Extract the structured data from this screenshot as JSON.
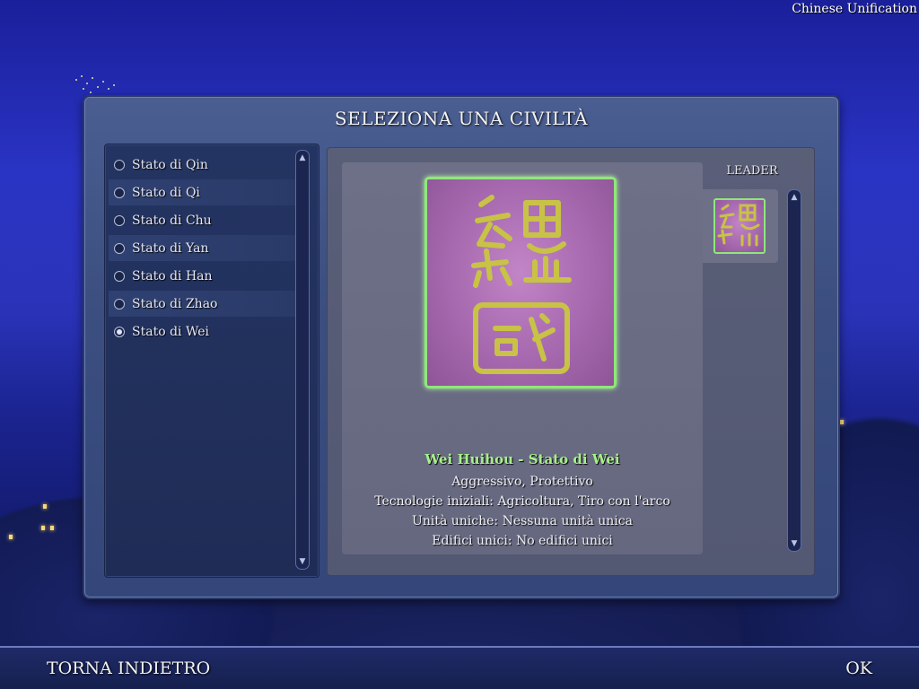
{
  "top_title": "Chinese Unification",
  "dialog": {
    "title": "SELEZIONA UNA CIVILTÀ"
  },
  "civilizations": [
    {
      "label": "Stato di Qin",
      "selected": false
    },
    {
      "label": "Stato di Qi",
      "selected": false
    },
    {
      "label": "Stato di Chu",
      "selected": false
    },
    {
      "label": "Stato di Yan",
      "selected": false
    },
    {
      "label": "Stato di Han",
      "selected": false
    },
    {
      "label": "Stato di Zhao",
      "selected": false
    },
    {
      "label": "Stato di Wei",
      "selected": true
    }
  ],
  "detail": {
    "leader_label": "LEADER",
    "civ_name": "Wei Huihou - Stato di Wei",
    "traits": "Aggressivo, Protettivo",
    "techs": "Tecnologie iniziali: Agricoltura, Tiro con l'arco",
    "units": "Unità uniche: Nessuna unità unica",
    "buildings": "Edifici unici: No edifici unici",
    "emblem_icon": "wei-seal-emblem",
    "accent_color": "#8ee87a"
  },
  "bottom": {
    "back_label": "TORNA INDIETRO",
    "ok_label": "OK"
  }
}
